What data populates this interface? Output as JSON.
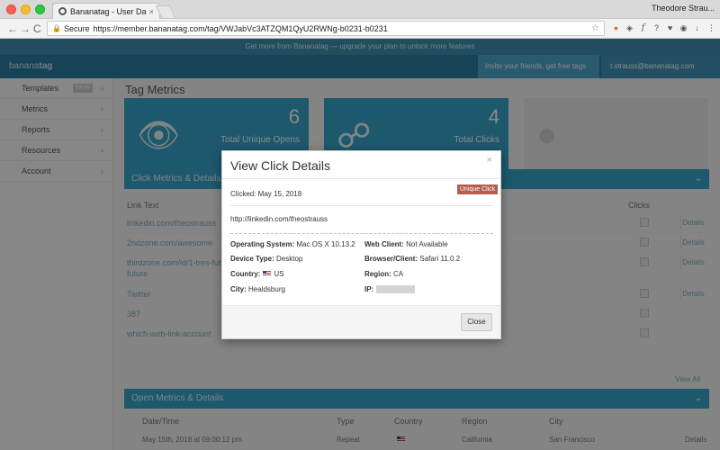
{
  "browser": {
    "tab_title": "Bananatag - User Dashboard",
    "tab_close": "×",
    "profile_name": "Theodore Strau...",
    "secure_label": "Secure",
    "url": "https://member.bananatag.com/tag/VWJabVc3ATZQM1QyU2RWNg-b0231-b0231",
    "nav_back": "←",
    "nav_forward": "→",
    "nav_reload": "C",
    "star": "☆"
  },
  "app": {
    "banner_text": "Get more from Bananatag — upgrade your plan to unlock more features",
    "logo_light": "banana",
    "logo_bold": "tag",
    "promo_text": "Invite your friends, get free tags",
    "user_text": "t.strauss@bananatag.com",
    "sidebar": [
      {
        "label": "Templates",
        "badge": "NEW"
      },
      {
        "label": "Metrics",
        "badge": ""
      },
      {
        "label": "Reports",
        "badge": ""
      },
      {
        "label": "Resources",
        "badge": ""
      },
      {
        "label": "Account",
        "badge": ""
      }
    ],
    "page_title": "Tag Metrics",
    "metrics": [
      {
        "number": "6",
        "label": "Total Unique Opens"
      },
      {
        "number": "4",
        "label": "Total Clicks"
      },
      {
        "number": "",
        "label": ""
      }
    ],
    "click_section_title": "Click Metrics & Details",
    "col_link_text": "Link Text",
    "col_clicks": "Clicks",
    "rows": [
      {
        "text": "linkedin.com/theostrauss",
        "details": "Details"
      },
      {
        "text": "2ndzone.com/awesome",
        "details": "Details"
      },
      {
        "text": "thirdzone.com/id/1-tres-futura",
        "details": "Details"
      },
      {
        "text": "future",
        "details": ""
      },
      {
        "text": "Twitter",
        "details": "Details"
      },
      {
        "text": "387",
        "details": ""
      },
      {
        "text": "which-web-link-account",
        "details": ""
      }
    ],
    "view_all": "View All",
    "open_section_title": "Open Metrics & Details",
    "open_headers": [
      "Date/Time",
      "Type",
      "Country",
      "Region",
      "City"
    ],
    "open_row": [
      "May 15th, 2018 at 09:00:12 pm",
      "Repeat",
      "",
      "California",
      "San Francisco"
    ],
    "open_row_details": "Details"
  },
  "modal": {
    "title": "View Click Details",
    "close_x": "×",
    "clicked_label": "Clicked: May 15, 2018",
    "badge": "Unique Click",
    "link_url": "http://linkedin.com/theostrauss",
    "os_label": "Operating System:",
    "os_value": "Mac OS X 10.13.2",
    "web_client_label": "Web Client:",
    "web_client_value": "Not Available",
    "device_label": "Device Type:",
    "device_value": "Desktop",
    "browser_label": "Browser/Client:",
    "browser_value": "Safari 11.0.2",
    "country_label": "Country:",
    "country_value": "US",
    "region_label": "Region:",
    "region_value": "CA",
    "city_label": "City:",
    "city_value": "Healdsburg",
    "ip_label": "IP:",
    "close_button": "Close"
  }
}
